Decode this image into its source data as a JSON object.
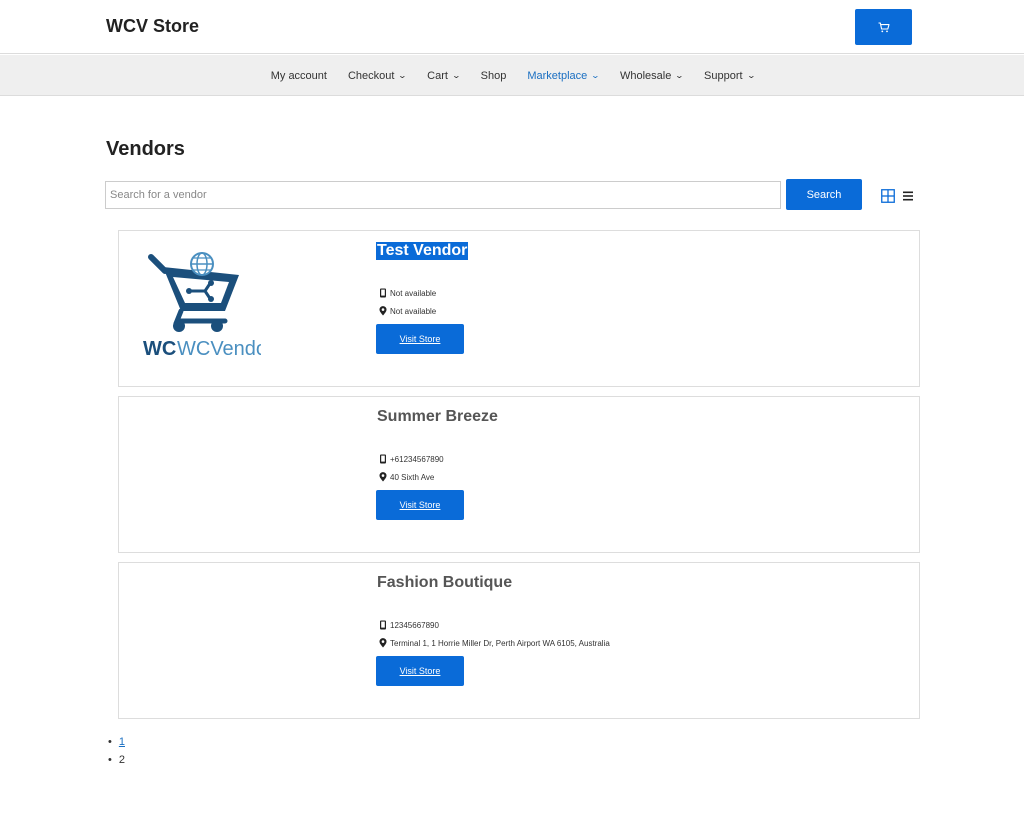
{
  "header": {
    "site_title": "WCV Store",
    "cart_icon": "cart-icon",
    "accent_color": "#0a6bd8"
  },
  "nav": {
    "items": [
      {
        "label": "My account",
        "has_dropdown": false,
        "active": false
      },
      {
        "label": "Checkout",
        "has_dropdown": true,
        "active": false
      },
      {
        "label": "Cart",
        "has_dropdown": true,
        "active": false
      },
      {
        "label": "Shop",
        "has_dropdown": false,
        "active": false
      },
      {
        "label": "Marketplace",
        "has_dropdown": true,
        "active": true
      },
      {
        "label": "Wholesale",
        "has_dropdown": true,
        "active": false
      },
      {
        "label": "Support",
        "has_dropdown": true,
        "active": false
      }
    ]
  },
  "page": {
    "title": "Vendors"
  },
  "search": {
    "placeholder": "Search for a vendor",
    "value": "",
    "button_label": "Search",
    "view_grid_icon": "grid-view-icon",
    "view_list_icon": "list-view-icon"
  },
  "vendors": [
    {
      "name": "Test Vendor",
      "phone": "Not available",
      "address": "Not available",
      "button_label": "Visit Store",
      "has_logo": true,
      "logo_text": "WCVendors",
      "selected": true
    },
    {
      "name": "Summer Breeze",
      "phone": "+61234567890",
      "address": "40 Sixth Ave",
      "button_label": "Visit Store",
      "has_logo": false,
      "selected": false
    },
    {
      "name": "Fashion Boutique",
      "phone": "12345667890",
      "address": "Terminal 1, 1 Horrie Miller Dr, Perth Airport WA 6105, Australia",
      "button_label": "Visit Store",
      "has_logo": false,
      "selected": false
    }
  ],
  "pagination": {
    "pages": [
      {
        "label": "1",
        "link": true
      },
      {
        "label": "2",
        "link": false
      }
    ]
  }
}
